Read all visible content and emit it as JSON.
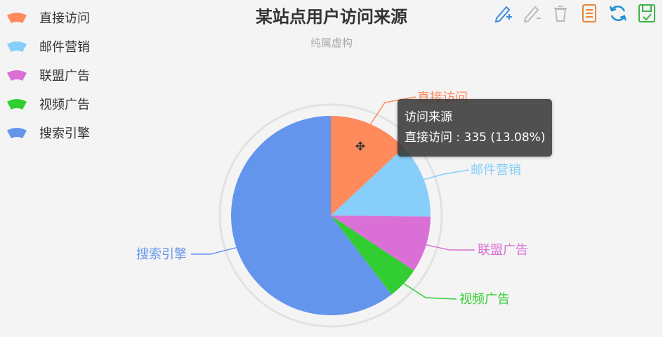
{
  "title": "某站点用户访问来源",
  "subtitle": "纯属虚构",
  "tooltip": {
    "title": "访问来源",
    "line": "直接访问 : 335 (13.08%)"
  },
  "toolbox": [
    {
      "name": "mark-icon",
      "color": "#3f8bd9"
    },
    {
      "name": "mark-undo-icon",
      "color": "#bbbbbb"
    },
    {
      "name": "mark-clear-icon",
      "color": "#bbbbbb"
    },
    {
      "name": "data-view-icon",
      "color": "#e8853a"
    },
    {
      "name": "restore-icon",
      "color": "#1e90d0"
    },
    {
      "name": "save-image-icon",
      "color": "#3fb24a"
    }
  ],
  "chart_data": {
    "type": "pie",
    "title": "某站点用户访问来源",
    "subtitle": "纯属虚构",
    "series_name": "访问来源",
    "legend_position": "top-left",
    "categories": [
      "直接访问",
      "邮件营销",
      "联盟广告",
      "视频广告",
      "搜索引擎"
    ],
    "values": [
      335,
      310,
      234,
      135,
      1548
    ],
    "colors": [
      "#ff8a5c",
      "#87cefa",
      "#da70d6",
      "#32cd32",
      "#6495ed"
    ]
  }
}
